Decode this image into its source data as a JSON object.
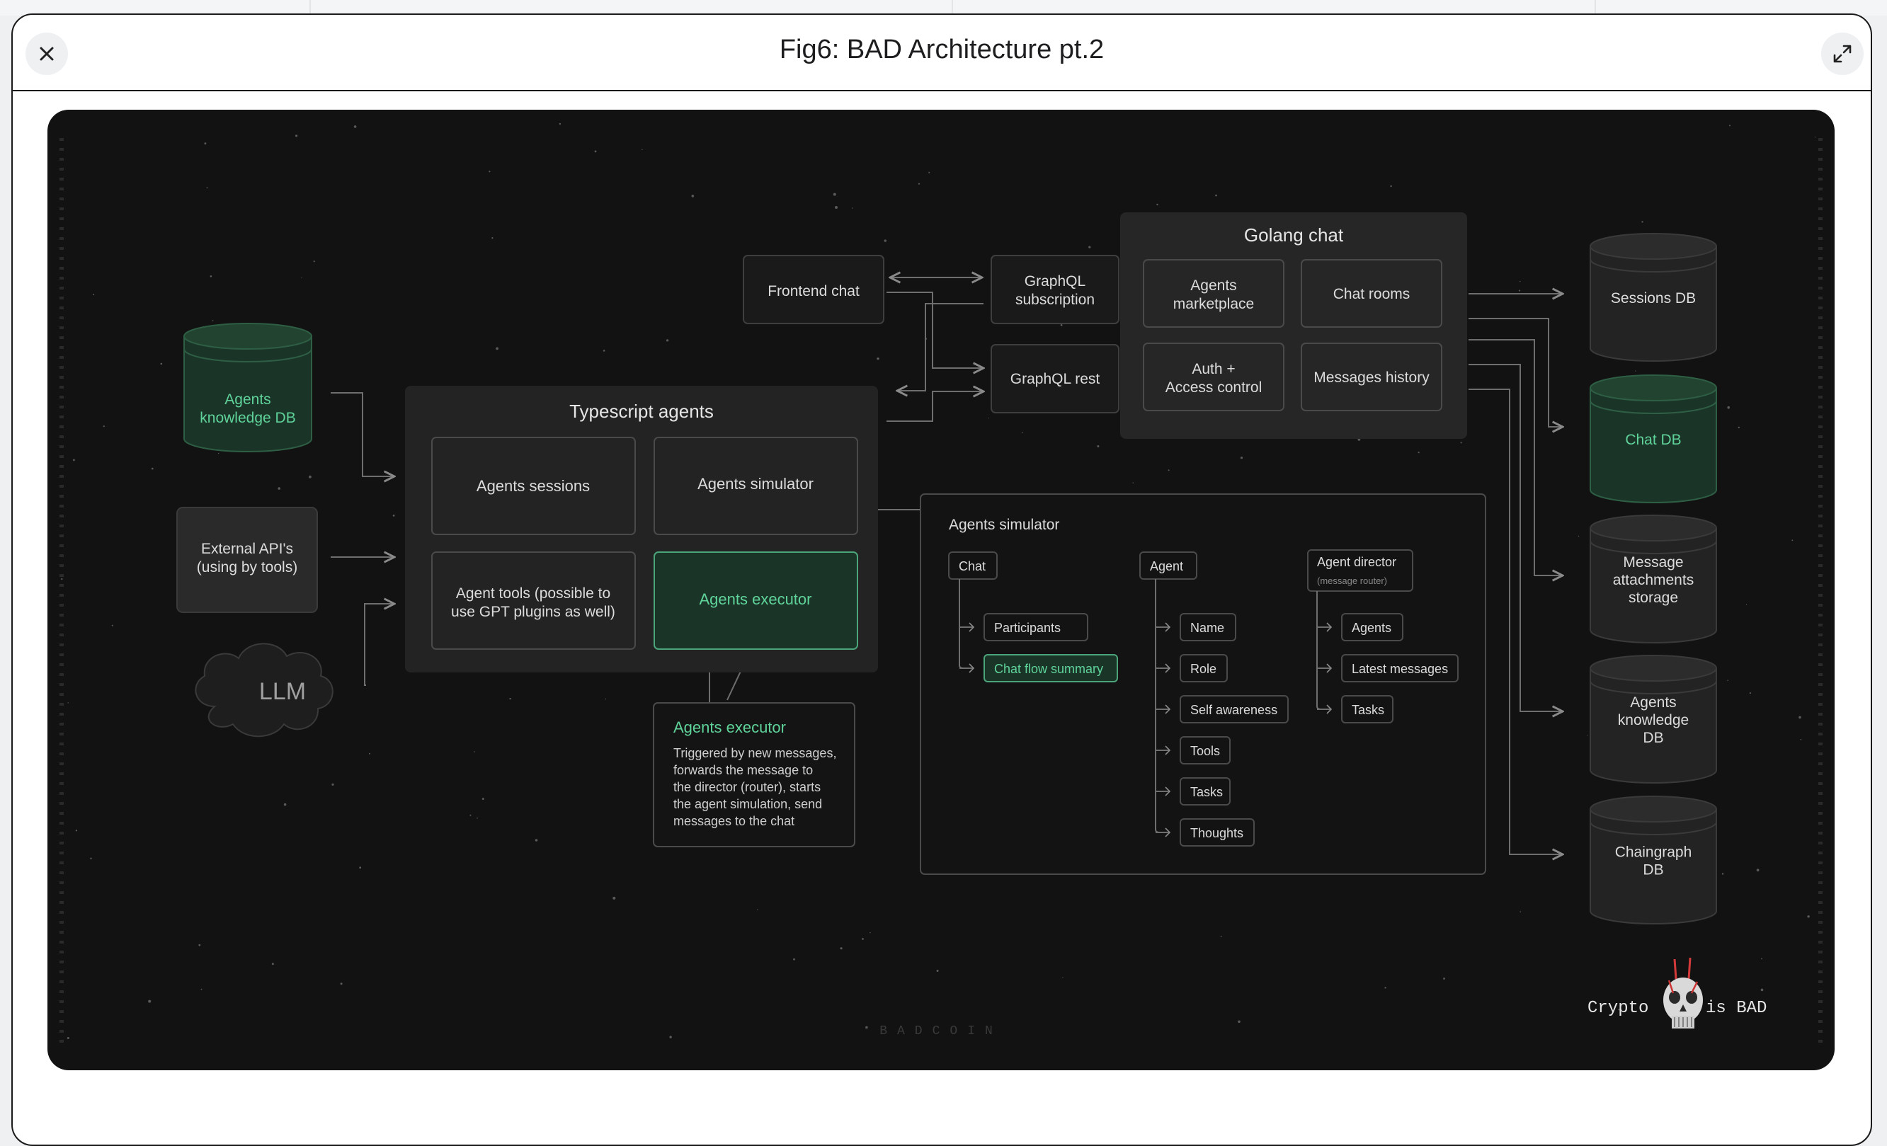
{
  "window": {
    "title": "Fig6: BAD Architecture pt.2",
    "close_icon": "close-icon",
    "expand_icon": "expand-icon"
  },
  "colors": {
    "canvas": "#121212",
    "panel": "#232323",
    "box_border": "#4a4a4a",
    "accent_green": "#5fd39a",
    "green_fill": "#1a3528"
  },
  "diagram": {
    "left": {
      "knowledge_db": [
        "Agents",
        "knowledge DB"
      ],
      "external_apis": [
        "External API's",
        "(using by tools)"
      ],
      "llm": "LLM"
    },
    "typescript": {
      "title": "Typescript agents",
      "sessions": "Agents sessions",
      "simulator": "Agents simulator",
      "tools": [
        "Agent tools (possible to",
        "use GPT plugins as well)"
      ],
      "executor": "Agents executor"
    },
    "executor_note": {
      "title": "Agents executor",
      "lines": [
        "Triggered by new messages,",
        "forwards the message to",
        "the director (router), starts",
        "the agent simulation, send",
        "messages to the chat"
      ]
    },
    "middle": {
      "frontend_chat": "Frontend chat",
      "graphql_subscription": [
        "GraphQL",
        "subscription"
      ],
      "graphql_rest": "GraphQL rest"
    },
    "golang": {
      "title": "Golang chat",
      "marketplace": [
        "Agents",
        "marketplace"
      ],
      "chat_rooms": "Chat rooms",
      "auth": [
        "Auth +",
        "Access control"
      ],
      "messages_history": "Messages history"
    },
    "simulator_detail": {
      "title": "Agents simulator",
      "chat": {
        "label": "Chat",
        "items": [
          "Participants",
          "Chat flow summary"
        ]
      },
      "agent": {
        "label": "Agent",
        "items": [
          "Name",
          "Role",
          "Self awareness",
          "Tools",
          "Tasks",
          "Thoughts"
        ]
      },
      "director": {
        "label": "Agent director",
        "sub": "(message router)",
        "items": [
          "Agents",
          "Latest messages",
          "Tasks"
        ]
      }
    },
    "databases": {
      "sessions": [
        "Sessions DB"
      ],
      "chat": [
        "Chat DB"
      ],
      "attachments": [
        "Message",
        "attachments",
        "storage"
      ],
      "knowledge": [
        "Agents",
        "knowledge",
        "DB"
      ],
      "chaingraph": [
        "Chaingraph",
        "DB"
      ]
    },
    "footer": {
      "brand": "BADCOIN",
      "crypto_left": "Crypto",
      "crypto_right": "is BAD",
      "skull_icon": "skull-icon"
    }
  }
}
